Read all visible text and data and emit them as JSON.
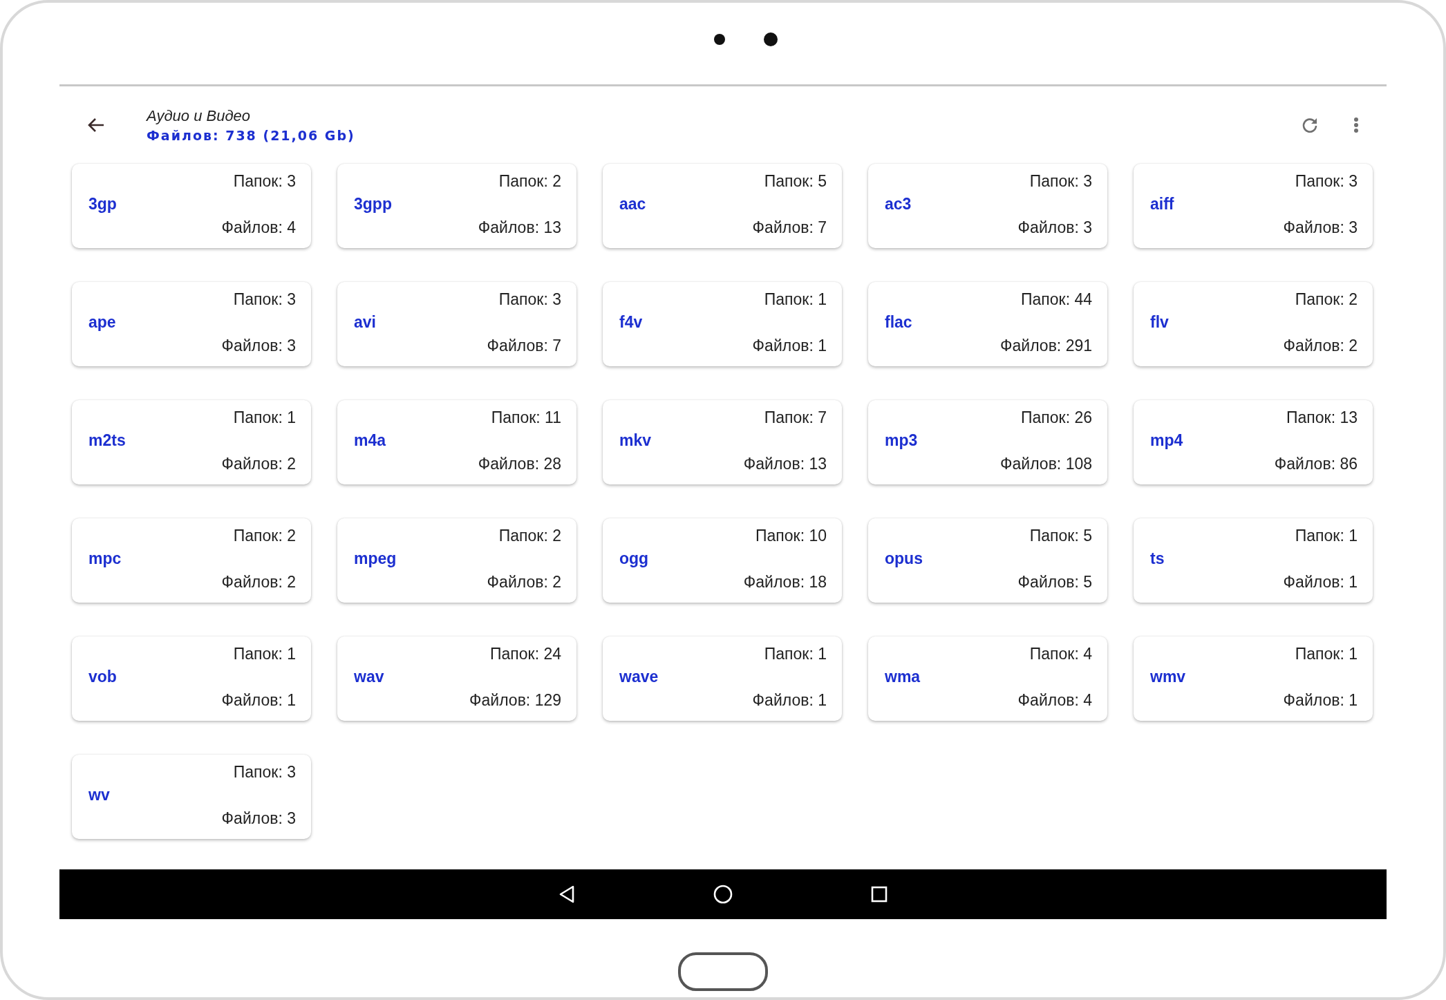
{
  "header": {
    "title": "Аудио и Видео",
    "subtitle": "Файлов: 738 (21,06 Gb)"
  },
  "cards": [
    {
      "extension": "3gp",
      "folders": "Папок: 3",
      "files": "Файлов: 4"
    },
    {
      "extension": "3gpp",
      "folders": "Папок: 2",
      "files": "Файлов: 13"
    },
    {
      "extension": "aac",
      "folders": "Папок: 5",
      "files": "Файлов: 7"
    },
    {
      "extension": "ac3",
      "folders": "Папок: 3",
      "files": "Файлов: 3"
    },
    {
      "extension": "aiff",
      "folders": "Папок: 3",
      "files": "Файлов: 3"
    },
    {
      "extension": "ape",
      "folders": "Папок: 3",
      "files": "Файлов: 3"
    },
    {
      "extension": "avi",
      "folders": "Папок: 3",
      "files": "Файлов: 7"
    },
    {
      "extension": "f4v",
      "folders": "Папок: 1",
      "files": "Файлов: 1"
    },
    {
      "extension": "flac",
      "folders": "Папок: 44",
      "files": "Файлов: 291"
    },
    {
      "extension": "flv",
      "folders": "Папок: 2",
      "files": "Файлов: 2"
    },
    {
      "extension": "m2ts",
      "folders": "Папок: 1",
      "files": "Файлов: 2"
    },
    {
      "extension": "m4a",
      "folders": "Папок: 11",
      "files": "Файлов: 28"
    },
    {
      "extension": "mkv",
      "folders": "Папок: 7",
      "files": "Файлов: 13"
    },
    {
      "extension": "mp3",
      "folders": "Папок: 26",
      "files": "Файлов: 108"
    },
    {
      "extension": "mp4",
      "folders": "Папок: 13",
      "files": "Файлов: 86"
    },
    {
      "extension": "mpc",
      "folders": "Папок: 2",
      "files": "Файлов: 2"
    },
    {
      "extension": "mpeg",
      "folders": "Папок: 2",
      "files": "Файлов: 2"
    },
    {
      "extension": "ogg",
      "folders": "Папок: 10",
      "files": "Файлов: 18"
    },
    {
      "extension": "opus",
      "folders": "Папок: 5",
      "files": "Файлов: 5"
    },
    {
      "extension": "ts",
      "folders": "Папок: 1",
      "files": "Файлов: 1"
    },
    {
      "extension": "vob",
      "folders": "Папок: 1",
      "files": "Файлов: 1"
    },
    {
      "extension": "wav",
      "folders": "Папок: 24",
      "files": "Файлов: 129"
    },
    {
      "extension": "wave",
      "folders": "Папок: 1",
      "files": "Файлов: 1"
    },
    {
      "extension": "wma",
      "folders": "Папок: 4",
      "files": "Файлов: 4"
    },
    {
      "extension": "wmv",
      "folders": "Папок: 1",
      "files": "Файлов: 1"
    },
    {
      "extension": "wv",
      "folders": "Папок: 3",
      "files": "Файлов: 3"
    }
  ]
}
